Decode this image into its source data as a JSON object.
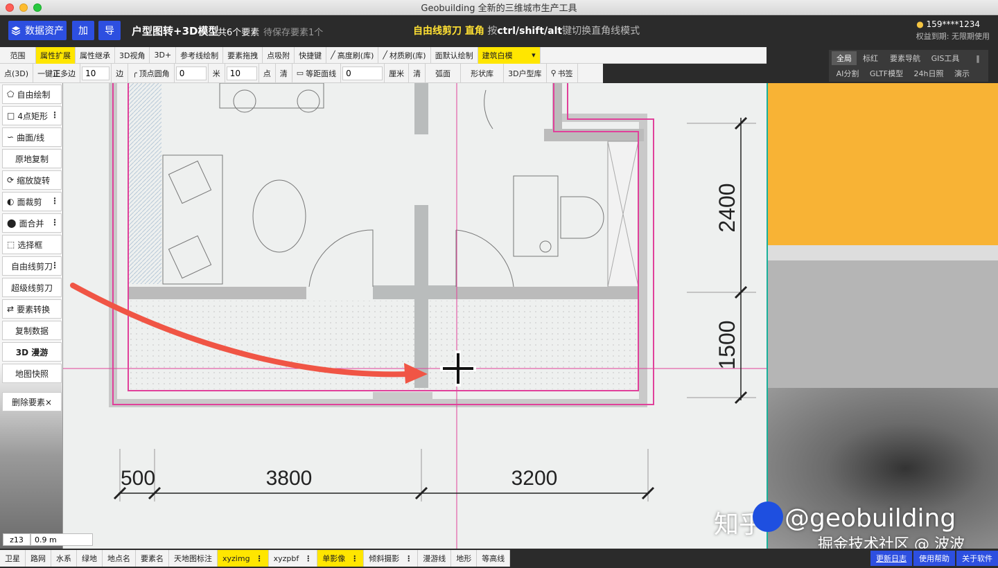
{
  "window": {
    "title": "Geobuilding 全新的三维城市生产工具"
  },
  "topbar": {
    "assets_label": "数据资产",
    "add_label": "加",
    "export_label": "导",
    "project_title": "户型图转+3D模型",
    "feature_count": "共6个要素",
    "pending_text": "待保存要素1个",
    "mode_name": "自由线剪刀 直角",
    "mode_hint_prefix": "按",
    "mode_keys": "ctrl/shift/alt",
    "mode_hint_suffix": "键切换直角线模式"
  },
  "account": {
    "user": "159****1234",
    "rights": "权益到期: 无限期使用"
  },
  "right_tabs": [
    "全局",
    "标红",
    "要素导航",
    "GIS工具",
    "AI分割",
    "GLTF模型",
    "24h日照",
    "演示"
  ],
  "toolbar1": [
    "范围",
    "属性扩展",
    "属性继承",
    "3D视角",
    "3D+",
    "参考线绘制",
    "要素拖拽",
    "点吸附",
    "快捷键",
    "高度刷(库)",
    "材质刷(库)",
    "面默认绘制"
  ],
  "toolbar1_select": "建筑白模",
  "toolbar2": {
    "point3d": "点(3D)",
    "polygon_label_a": "一键",
    "polygon_label_b": "正",
    "polygon_label_c": "多边",
    "sides_value": "10",
    "sides_unit": "边",
    "vertex_round": "顶点圆角",
    "round_value": "0",
    "round_unit": "米",
    "points_value": "10",
    "points_unit": "点",
    "clear1": "清",
    "equidistant": "等距面线",
    "equi_value": "0",
    "equi_unit": "厘米",
    "clear2": "清",
    "arc": "弧面",
    "shape_lib": "形状库",
    "house_lib": "3D户型库",
    "bookmark": "书签"
  },
  "sidebar": [
    "自由绘制",
    "4点矩形",
    "曲面/线",
    "原地复制",
    "缩放旋转",
    "面裁剪",
    "面合并",
    "选择框",
    "自由线剪刀",
    "超级线剪刀",
    "要素转换",
    "复制数据",
    "3D 漫游",
    "地图快照",
    "删除要素×"
  ],
  "dimensions": {
    "d2400": "2400",
    "d1500": "1500",
    "d500": "500",
    "d3800": "3800",
    "d3200": "3200"
  },
  "zoom": {
    "level": "z13",
    "scale": "0.9 m"
  },
  "bottom_layers": [
    "卫星",
    "路网",
    "水系",
    "绿地",
    "地点名",
    "要素名",
    "天地图标注",
    "xyzimg",
    "xyzpbf",
    "单影像",
    "倾斜摄影",
    "漫游线",
    "地形",
    "等高线"
  ],
  "bottom_right": [
    "更新日志",
    "使用帮助",
    "关于软件"
  ],
  "watermark": {
    "zhihu": "知乎",
    "handle": "@geobuilding",
    "juejin": "掘金技术社区 @ 波波"
  },
  "colors": {
    "accent_blue": "#2d4fe0",
    "highlight_yellow": "#ffe600",
    "guide_magenta": "#e0409a",
    "arrow_red": "#f05545",
    "teal_line": "#19b09a"
  }
}
